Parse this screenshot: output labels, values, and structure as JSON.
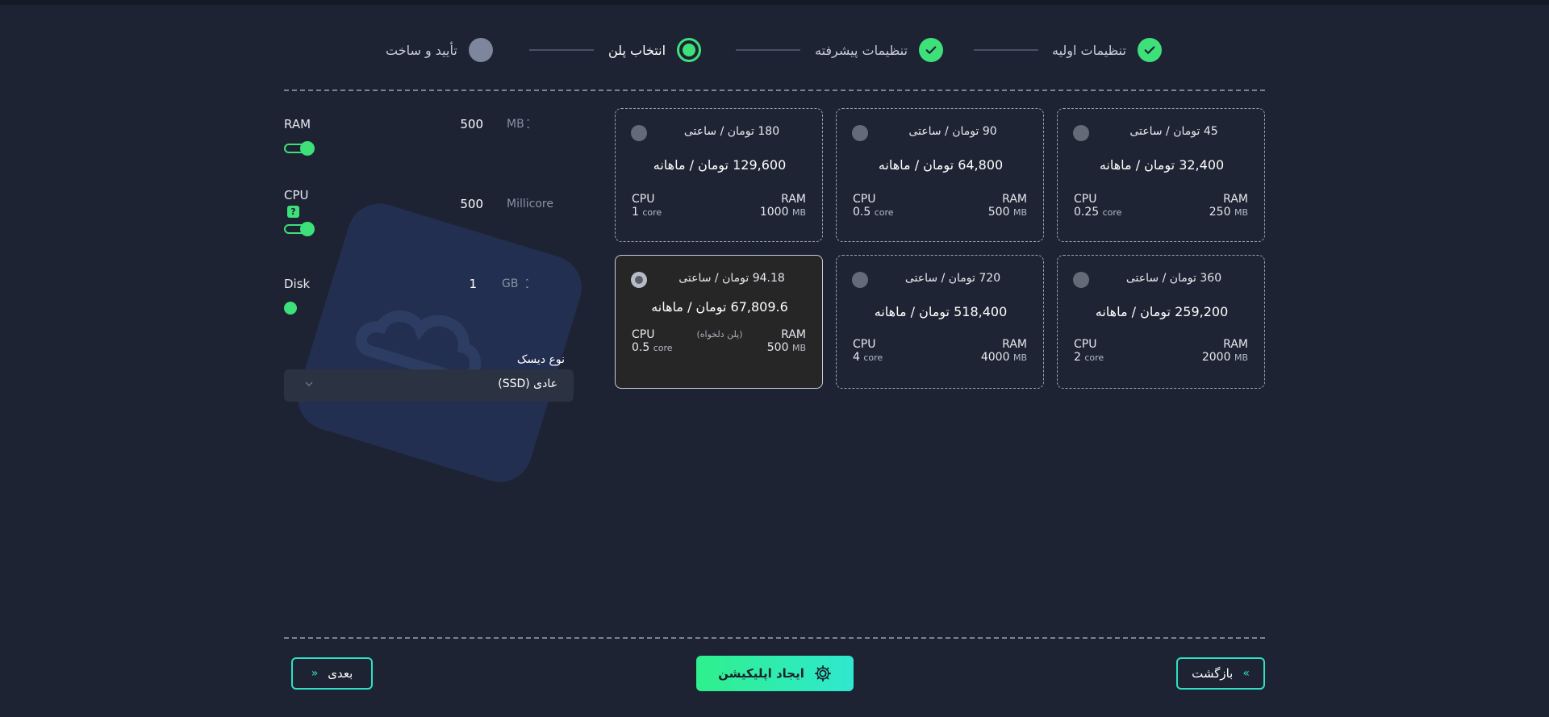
{
  "steps": [
    {
      "label": "تنظیمات اولیه",
      "state": "done"
    },
    {
      "label": "تنظیمات پیشرفته",
      "state": "done"
    },
    {
      "label": "انتخاب پلن",
      "state": "active"
    },
    {
      "label": "تأیید و ساخت",
      "state": "pending"
    }
  ],
  "plans": [
    {
      "hourly": "45 تومان / ساعتی",
      "monthly": "32,400 تومان / ماهانه",
      "ram_label": "RAM",
      "ram_value": "250",
      "ram_unit": "MB",
      "cpu_label": "CPU",
      "cpu_value": "0.25",
      "cpu_unit": "core",
      "selected": false
    },
    {
      "hourly": "90 تومان / ساعتی",
      "monthly": "64,800 تومان / ماهانه",
      "ram_label": "RAM",
      "ram_value": "500",
      "ram_unit": "MB",
      "cpu_label": "CPU",
      "cpu_value": "0.5",
      "cpu_unit": "core",
      "selected": false
    },
    {
      "hourly": "180 تومان / ساعتی",
      "monthly": "129,600 تومان / ماهانه",
      "ram_label": "RAM",
      "ram_value": "1000",
      "ram_unit": "MB",
      "cpu_label": "CPU",
      "cpu_value": "1",
      "cpu_unit": "core",
      "selected": false
    },
    {
      "hourly": "360 تومان / ساعتی",
      "monthly": "259,200 تومان / ماهانه",
      "ram_label": "RAM",
      "ram_value": "2000",
      "ram_unit": "MB",
      "cpu_label": "CPU",
      "cpu_value": "2",
      "cpu_unit": "core",
      "selected": false
    },
    {
      "hourly": "720 تومان / ساعتی",
      "monthly": "518,400 تومان / ماهانه",
      "ram_label": "RAM",
      "ram_value": "4000",
      "ram_unit": "MB",
      "cpu_label": "CPU",
      "cpu_value": "4",
      "cpu_unit": "core",
      "selected": false
    },
    {
      "hourly": "94.18 تومان / ساعتی",
      "monthly": "67,809.6 تومان / ماهانه",
      "ram_label": "RAM",
      "ram_value": "500",
      "ram_unit": "MB",
      "cpu_label": "CPU",
      "cpu_value": "0.5",
      "cpu_unit": "core",
      "selected": true,
      "tag": "(پلن دلخواه)"
    }
  ],
  "resources": {
    "ram": {
      "label": "RAM",
      "value": "500",
      "unit": "MB"
    },
    "cpu": {
      "label": "CPU",
      "value": "500",
      "unit": "Millicore",
      "help": "?"
    },
    "disk": {
      "label": "Disk",
      "value": "1",
      "unit": "GB"
    }
  },
  "disk_type": {
    "label": "نوع دیسک",
    "value": "عادی (SSD)"
  },
  "buttons": {
    "back": "بازگشت",
    "create": "ایجاد اپلیکیشن",
    "next": "بعدی"
  },
  "colors": {
    "accent": "#3ee07a",
    "background": "#1d2333",
    "button_border": "#2fe0c4"
  },
  "icons": {
    "step_done": "check-icon",
    "back": "double-chevron-right-icon",
    "next": "double-chevron-left-icon",
    "create": "gear-icon",
    "select": "chevron-down-icon"
  }
}
